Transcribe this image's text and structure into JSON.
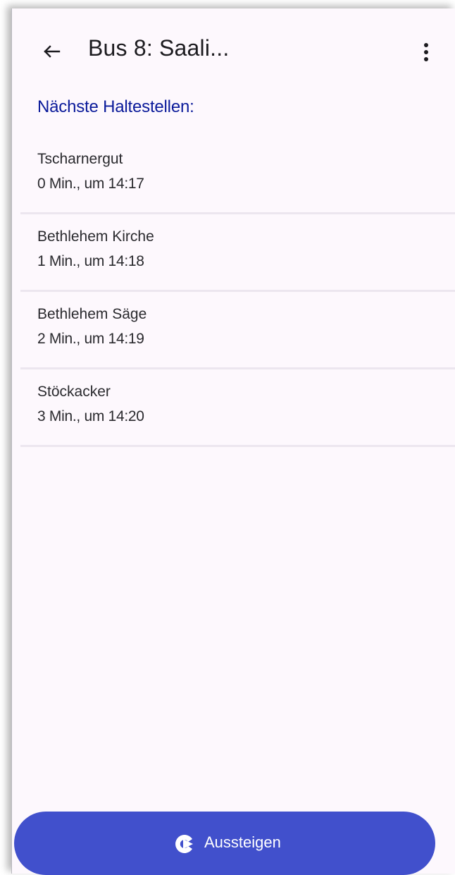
{
  "app_bar": {
    "title": "Bus 8: Saali...",
    "back_icon": "arrow-left-icon",
    "menu_icon": "more-vert-icon"
  },
  "section": {
    "title": "Nächste Haltestellen:"
  },
  "stops": [
    {
      "name": "Tscharnergut",
      "time": "0 Min., um 14:17"
    },
    {
      "name": "Bethlehem Kirche",
      "time": "1 Min., um 14:18"
    },
    {
      "name": "Bethlehem Säge",
      "time": "2 Min., um 14:19"
    },
    {
      "name": "Stöckacker",
      "time": "3 Min., um 14:20"
    }
  ],
  "action_button": {
    "label": "Aussteigen",
    "icon": "exit-icon"
  },
  "colors": {
    "background": "#fdf8fd",
    "section_title": "#0a1a9a",
    "button": "#4150cc",
    "divider": "#ece6ef"
  }
}
